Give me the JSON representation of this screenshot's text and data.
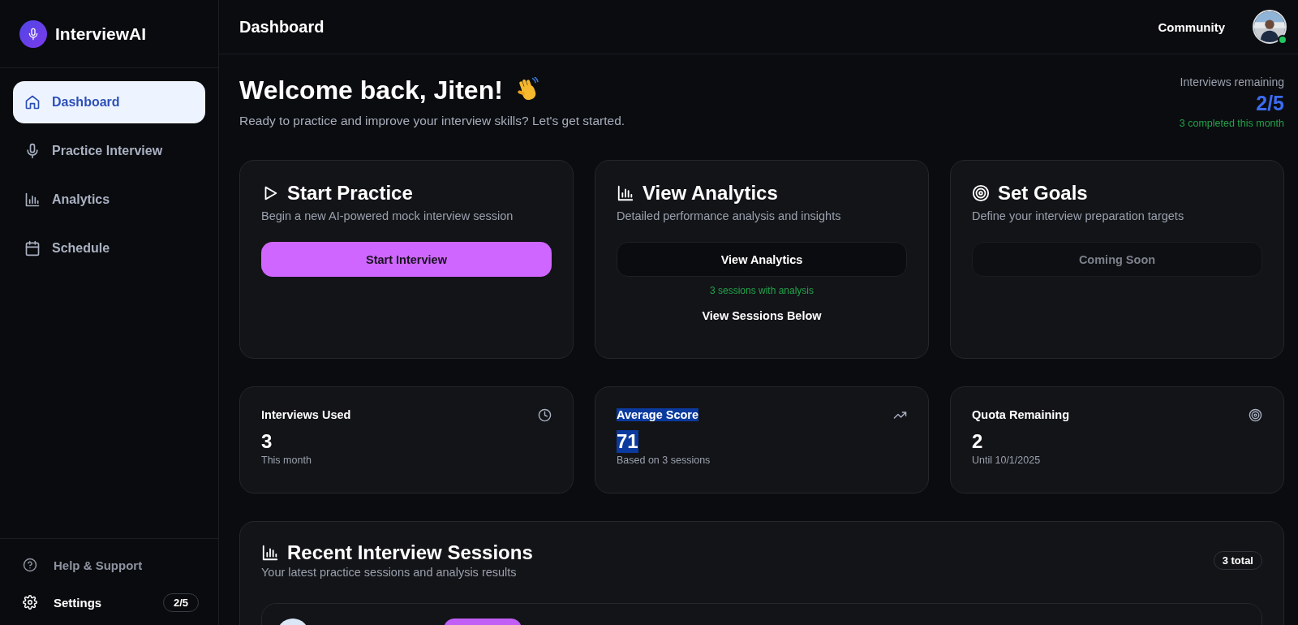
{
  "brand": {
    "name": "InterviewAI"
  },
  "sidebar": {
    "items": [
      {
        "label": "Dashboard",
        "selected": true
      },
      {
        "label": "Practice Interview",
        "selected": false
      },
      {
        "label": "Analytics",
        "selected": false
      },
      {
        "label": "Schedule",
        "selected": false
      }
    ],
    "footer": [
      {
        "label": "Help & Support",
        "muted": true
      },
      {
        "label": "Settings",
        "muted": false,
        "badge": "2/5"
      }
    ]
  },
  "header": {
    "title": "Dashboard",
    "link": "Community",
    "online": true
  },
  "welcome": {
    "title": "Welcome back, Jiten!",
    "subtitle": "Ready to practice and improve your interview skills? Let's get started."
  },
  "quota": {
    "label": "Interviews remaining",
    "value": "2/5",
    "note": "3 completed this month"
  },
  "actions": [
    {
      "title": "Start Practice",
      "description": "Begin a new AI-powered mock interview session",
      "button": "Start Interview",
      "kind": "primary"
    },
    {
      "title": "View Analytics",
      "description": "Detailed performance analysis and insights",
      "button": "View Analytics",
      "kind": "secondary",
      "note": "3 sessions with analysis",
      "link": "View Sessions Below"
    },
    {
      "title": "Set Goals",
      "description": "Define your interview preparation targets",
      "button": "Coming Soon",
      "kind": "disabled"
    }
  ],
  "stats": [
    {
      "label": "Interviews Used",
      "value": "3",
      "note": "This month",
      "highlighted": false
    },
    {
      "label": "Average Score",
      "value": "71",
      "note": "Based on 3 sessions",
      "highlighted": true
    },
    {
      "label": "Quota Remaining",
      "value": "2",
      "note": "Until 10/1/2025",
      "highlighted": false
    }
  ],
  "recent": {
    "title": "Recent Interview Sessions",
    "subtitle": "Your latest practice sessions and analysis results",
    "count": "3 total"
  }
}
